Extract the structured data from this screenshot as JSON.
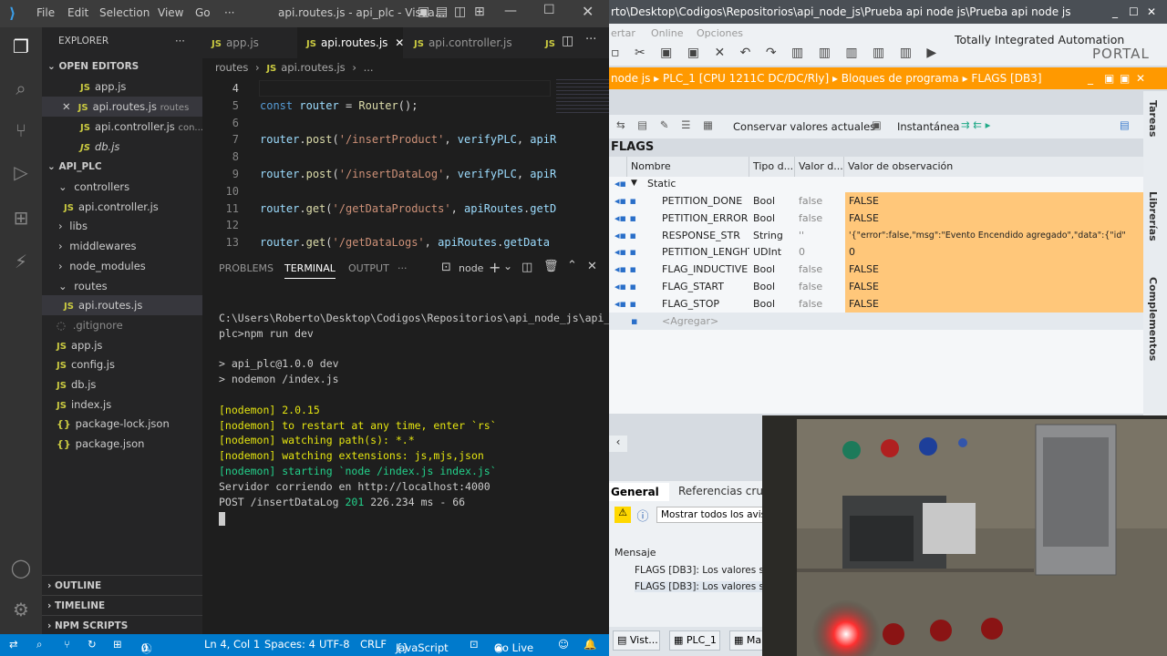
{
  "vscode": {
    "window_title": "api.routes.js - api_plc - Visua...",
    "menu": [
      "File",
      "Edit",
      "Selection",
      "View",
      "Go",
      "···"
    ],
    "explorer_title": "EXPLORER",
    "open_editors_title": "OPEN EDITORS",
    "open_editors": [
      {
        "name": "app.js",
        "hint": ""
      },
      {
        "name": "api.routes.js",
        "hint": "routes"
      },
      {
        "name": "api.controller.js",
        "hint": "con..."
      },
      {
        "name": "db.js",
        "hint": ""
      }
    ],
    "project_title": "API_PLC",
    "tree": [
      {
        "name": "controllers",
        "type": "folder",
        "open": true
      },
      {
        "name": "api.controller.js",
        "type": "js"
      },
      {
        "name": "libs",
        "type": "folder"
      },
      {
        "name": "middlewares",
        "type": "folder"
      },
      {
        "name": "node_modules",
        "type": "folder"
      },
      {
        "name": "routes",
        "type": "folder",
        "open": true
      },
      {
        "name": "api.routes.js",
        "type": "js"
      },
      {
        "name": ".gitignore",
        "type": "file"
      },
      {
        "name": "app.js",
        "type": "js"
      },
      {
        "name": "config.js",
        "type": "js"
      },
      {
        "name": "db.js",
        "type": "js"
      },
      {
        "name": "index.js",
        "type": "js"
      },
      {
        "name": "package-lock.json",
        "type": "json"
      },
      {
        "name": "package.json",
        "type": "json"
      }
    ],
    "outline_label": "OUTLINE",
    "timeline_label": "TIMELINE",
    "npm_scripts_label": "NPM SCRIPTS",
    "tabs": [
      "app.js",
      "api.routes.js",
      "api.controller.js"
    ],
    "breadcrumb": [
      "routes",
      "api.routes.js",
      "..."
    ],
    "code_lines": [
      {
        "n": "4",
        "text": ""
      },
      {
        "n": "5",
        "text": "const router = Router();"
      },
      {
        "n": "6",
        "text": ""
      },
      {
        "n": "7",
        "text": "router.post('/insertProduct', verifyPLC, apiR"
      },
      {
        "n": "8",
        "text": ""
      },
      {
        "n": "9",
        "text": "router.post('/insertDataLog', verifyPLC, apiR"
      },
      {
        "n": "10",
        "text": ""
      },
      {
        "n": "11",
        "text": "router.get('/getDataProducts', apiRoutes.getD"
      },
      {
        "n": "12",
        "text": ""
      },
      {
        "n": "13",
        "text": "router.get('/getDataLogs', apiRoutes.getData"
      }
    ],
    "panel_tabs": [
      "PROBLEMS",
      "TERMINAL",
      "OUTPUT",
      "···"
    ],
    "terminal_name": "node",
    "terminal_lines": [
      "C:\\Users\\Roberto\\Desktop\\Codigos\\Repositorios\\api_node_js\\api_",
      "plc>npm run dev",
      "",
      "> api_plc@1.0.0 dev",
      "> nodemon /index.js",
      "",
      "[nodemon] 2.0.15",
      "[nodemon] to restart at any time, enter `rs`",
      "[nodemon] watching path(s): *.*",
      "[nodemon] watching extensions: js,mjs,json",
      "[nodemon] starting `node /index.js index.js`",
      "Servidor corriendo en http://localhost:4000",
      "POST /insertDataLog 201 226.234 ms - 66"
    ],
    "status": {
      "errors": "0",
      "warnings": "0",
      "position": "Ln 4, Col 1",
      "spaces": "Spaces: 4",
      "encoding": "UTF-8",
      "eol": "CRLF",
      "language": "JavaScript",
      "golive": "Go Live"
    },
    "accent": "#007acc"
  },
  "tia": {
    "window_title": "rto\\Desktop\\Codigos\\Repositorios\\api_node_js\\Prueba api node js\\Prueba api node js",
    "toolbar_labels": [
      "ertar",
      "Online",
      "Opciones"
    ],
    "brand_line1": "Totally Integrated Automation",
    "brand_line2": "PORTAL",
    "breadcrumb": "node js  ▸  PLC_1 [CPU 1211C DC/DC/Rly]  ▸  Bloques de programa  ▸  FLAGS [DB3]",
    "monitor_button": "Conservar valores actuales",
    "snapshot_button": "Instantánea",
    "block_title": "FLAGS",
    "columns": [
      "Nombre",
      "Tipo d...",
      "Valor d...",
      "Valor de observación"
    ],
    "section": "Static",
    "rows": [
      {
        "name": "PETITION_DONE",
        "type": "Bool",
        "default": "false",
        "observed": "FALSE"
      },
      {
        "name": "PETITION_ERROR",
        "type": "Bool",
        "default": "false",
        "observed": "FALSE"
      },
      {
        "name": "RESPONSE_STR",
        "type": "String",
        "default": "''",
        "observed": "'{\"error\":false,\"msg\":\"Evento Encendido agregado\",\"data\":{\"id\""
      },
      {
        "name": "PETITION_LENGHT",
        "type": "UDInt",
        "default": "0",
        "observed": "0"
      },
      {
        "name": "FLAG_INDUCTIVE",
        "type": "Bool",
        "default": "false",
        "observed": "FALSE"
      },
      {
        "name": "FLAG_START",
        "type": "Bool",
        "default": "false",
        "observed": "FALSE"
      },
      {
        "name": "FLAG_STOP",
        "type": "Bool",
        "default": "false",
        "observed": "FALSE"
      }
    ],
    "add_row": "<Agregar>",
    "side_tabs": [
      "Tareas",
      "Librerías",
      "Complementos"
    ],
    "inspector_tabs": [
      "General",
      "Referencias cru"
    ],
    "show_all_label": "Mostrar todos los aviso",
    "message_header": "Mensaje",
    "messages": [
      "FLAGS [DB3]: Los valores se",
      "FLAGS [DB3]: Los valores se"
    ],
    "taskbar": [
      "Vist...",
      "PLC_1",
      "Ma"
    ],
    "highlight_color": "#ffc77a",
    "orange": "#ff9900"
  }
}
